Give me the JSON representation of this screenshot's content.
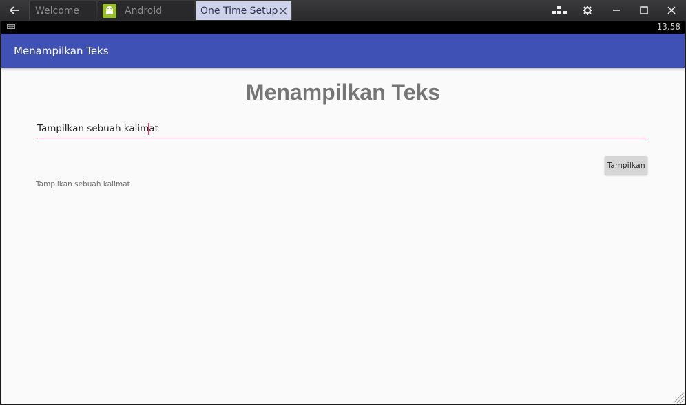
{
  "window": {
    "tabs": [
      {
        "label": "Welcome"
      },
      {
        "label": "Android"
      },
      {
        "label": "One Time Setup"
      }
    ],
    "controls": [
      "back-icon",
      "keyboard-layout-icon",
      "gear-icon",
      "minimize-icon",
      "maximize-icon",
      "close-icon"
    ]
  },
  "statusbar": {
    "time": "13.58"
  },
  "appbar": {
    "title": "Menampilkan Teks",
    "color": "#3f51b5"
  },
  "main": {
    "heading": "Menampilkan Teks",
    "input_value": "Tampilkan sebuah kalimat",
    "button_label": "Tampilkan",
    "output_text": "Tampilkan sebuah kalimat",
    "accent_color": "#e0407a"
  }
}
